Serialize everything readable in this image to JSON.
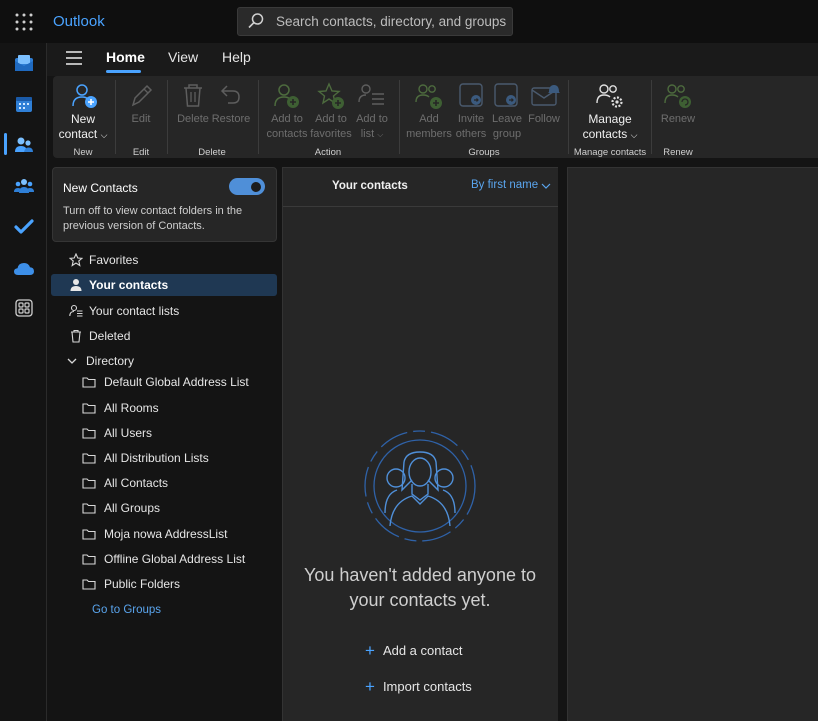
{
  "app": {
    "title": "Outlook"
  },
  "search": {
    "placeholder": "Search contacts, directory, and groups"
  },
  "rail": {
    "items": [
      "mail-icon",
      "calendar-icon",
      "people-icon",
      "groups-icon",
      "todo-icon",
      "onedrive-icon",
      "apps-icon"
    ],
    "selected": "people-icon"
  },
  "tabs": {
    "home": "Home",
    "view": "View",
    "help": "Help"
  },
  "ribbon": {
    "new": {
      "line1": "New",
      "line2": "contact",
      "group": "New"
    },
    "edit": {
      "label": "Edit",
      "group": "Edit"
    },
    "delete": {
      "label": "Delete",
      "group": "Delete"
    },
    "restore": {
      "label": "Restore"
    },
    "add_to_contacts": {
      "line1": "Add to",
      "line2": "contacts"
    },
    "add_to_favorites": {
      "line1": "Add to",
      "line2": "favorites"
    },
    "add_to_list": {
      "line1": "Add to",
      "line2": "list"
    },
    "action_group": "Action",
    "add_members": {
      "line1": "Add",
      "line2": "members"
    },
    "invite_others": {
      "line1": "Invite",
      "line2": "others"
    },
    "leave_group": {
      "line1": "Leave",
      "line2": "group"
    },
    "follow": {
      "label": "Follow"
    },
    "groups_group": "Groups",
    "manage_contacts": {
      "line1": "Manage",
      "line2": "contacts",
      "group": "Manage contacts"
    },
    "renew": {
      "label": "Renew",
      "group": "Renew"
    }
  },
  "new_contacts_card": {
    "title": "New Contacts",
    "toggle_on": true,
    "description": "Turn off to view contact folders in the previous version of Contacts."
  },
  "nav": {
    "favorites": "Favorites",
    "your_contacts": "Your contacts",
    "your_contact_lists": "Your contact lists",
    "deleted": "Deleted",
    "directory": "Directory",
    "directory_items": [
      "Default Global Address List",
      "All Rooms",
      "All Users",
      "All Distribution Lists",
      "All Contacts",
      "All Groups",
      "Moja nowa AddressList",
      "Offline Global Address List",
      "Public Folders"
    ],
    "go_to_groups": "Go to Groups"
  },
  "list": {
    "title": "Your contacts",
    "sort": "By first name",
    "empty_message": "You haven't added anyone to your contacts yet.",
    "add_contact": "Add a contact",
    "import_contacts": "Import contacts"
  },
  "colors": {
    "accent": "#4aa3ff",
    "selected_nav": "#1f3853",
    "pane": "#262626"
  }
}
